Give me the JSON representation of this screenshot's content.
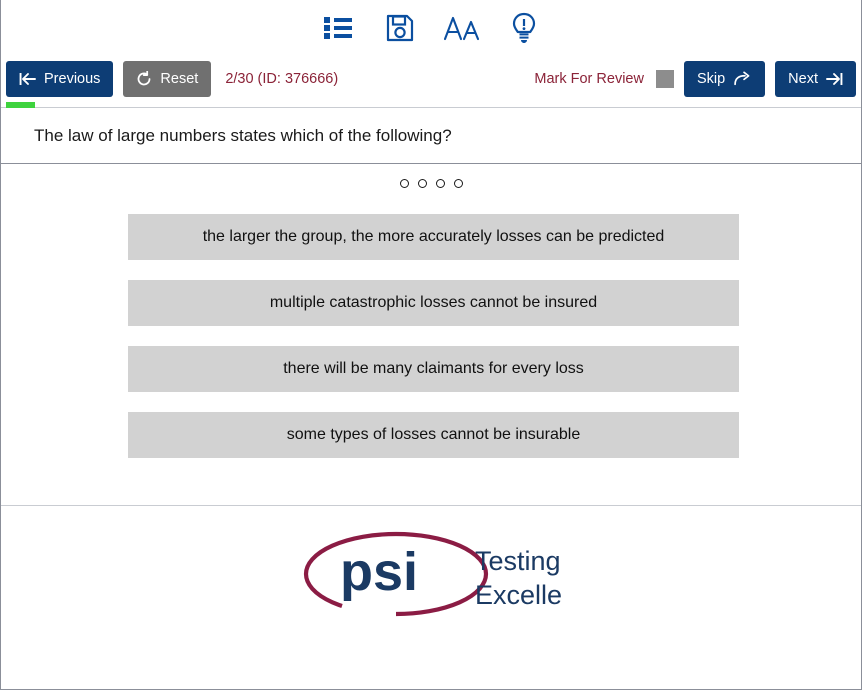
{
  "toolbar": {
    "icons": [
      {
        "name": "list-icon",
        "label": "Question List"
      },
      {
        "name": "save-icon",
        "label": "Save"
      },
      {
        "name": "font-size-icon",
        "label": "Font Size"
      },
      {
        "name": "hint-icon",
        "label": "Hint"
      }
    ]
  },
  "navbar": {
    "previous_label": "Previous",
    "reset_label": "Reset",
    "counter": "2/30 (ID: 376666)",
    "mark_for_review_label": "Mark For Review",
    "skip_label": "Skip",
    "next_label": "Next"
  },
  "progress": {
    "percent": 6.7
  },
  "question": {
    "text": "The law of large numbers states which of the following?"
  },
  "answers": {
    "indicator_count": 4,
    "options": [
      {
        "text": "the larger the group, the more accurately losses can be predicted"
      },
      {
        "text": "multiple catastrophic losses cannot be insured"
      },
      {
        "text": "there will be many claimants for every loss"
      },
      {
        "text": "some types of losses cannot be insurable"
      }
    ]
  },
  "footer": {
    "logo_mark": "psi",
    "logo_line1": "Testing",
    "logo_line2": "Excellence"
  },
  "colors": {
    "navy": "#0d3d75",
    "gray_button": "#707070",
    "maroon": "#8b2338",
    "progress_green": "#3ed33e",
    "option_gray": "#d2d2d2",
    "icon_blue": "#0b4fa0",
    "logo_maroon": "#8b1c44",
    "logo_navy": "#1b3a63"
  }
}
